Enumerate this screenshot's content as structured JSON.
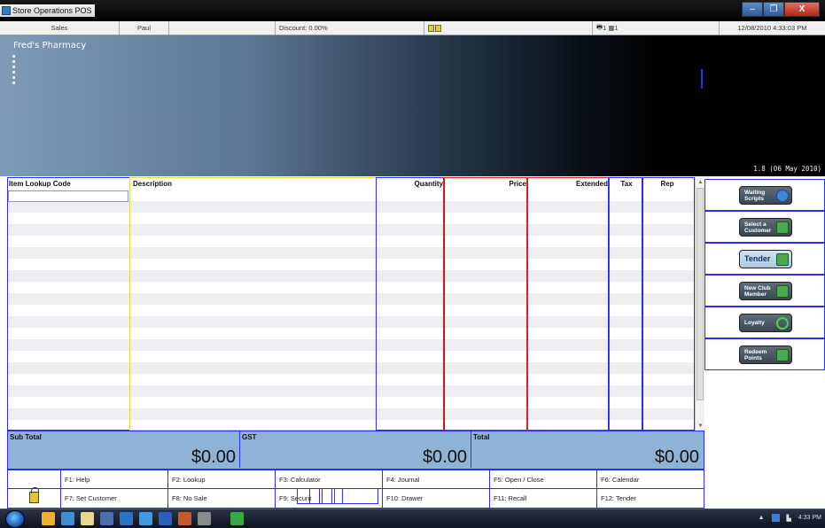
{
  "window": {
    "title": "Store Operations POS",
    "controls": [
      "–",
      "❐",
      "X"
    ]
  },
  "status": {
    "mode": "Sales",
    "cashier": "Paul",
    "discount": "Discount: 0.00%",
    "register": "1",
    "drawer": "1",
    "datetime": "12/08/2010 4:33:03 PM"
  },
  "banner": {
    "store_name": "Fred's Pharmacy",
    "version": "1.8 (06 May 2010)"
  },
  "grid": {
    "columns": [
      "Item Lookup Code",
      "Description",
      "Quantity",
      "Price",
      "Extended",
      "Tax",
      "Rep"
    ],
    "colors": {
      "lookup": "#2b2bff",
      "description": "#e0d84a",
      "quantity": "#2b2bff",
      "price": "#e02020",
      "extended": "#e02020",
      "tax": "#2b2bff",
      "rep": "#2b2bff"
    }
  },
  "totals": {
    "subtotal_label": "Sub Total",
    "subtotal_value": "$0.00",
    "gst_label": "GST",
    "gst_value": "$0.00",
    "total_label": "Total",
    "total_value": "$0.00"
  },
  "fkeys": {
    "f1": "F1: Help",
    "f2": "F2: Lookup",
    "f3": "F3: Calculator",
    "f4": "F4: Journal",
    "f5": "F5: Open / Close",
    "f6": "F6: Calendar",
    "f7": "F7: Set Customer",
    "f8": "F8: No Sale",
    "f9": "F9: Securit",
    "f10": "F10: Drawer",
    "f11": "F11: Recall",
    "f12": "F12: Tender"
  },
  "side_buttons": [
    {
      "label": "Waiting Scripts",
      "icon": "pills-icon"
    },
    {
      "label": "Select a Customer",
      "icon": "customer-icon"
    },
    {
      "label": "Tender",
      "icon": "tender-icon"
    },
    {
      "label": "New Club Member",
      "icon": "member-icon"
    },
    {
      "label": "Loyalty",
      "icon": "heart-icon"
    },
    {
      "label": "Redeem Points",
      "icon": "points-icon"
    }
  ],
  "taskbar": {
    "clock": "4:33 PM"
  }
}
